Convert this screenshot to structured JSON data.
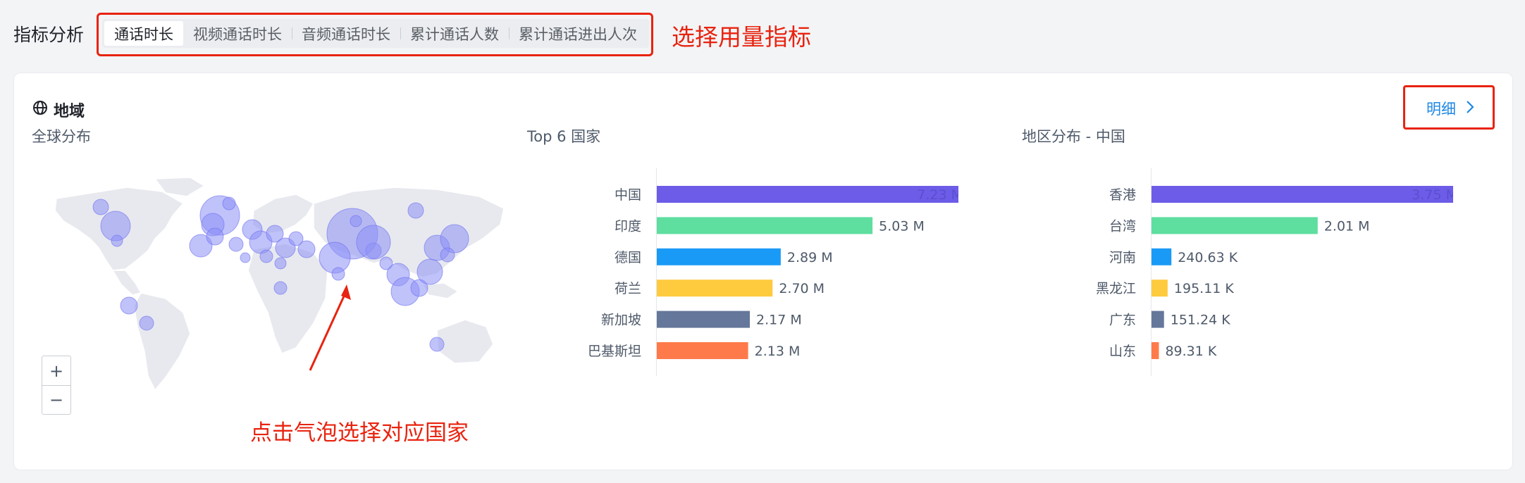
{
  "metrics": {
    "label": "指标分析",
    "tabs": [
      {
        "label": "通话时长",
        "active": true
      },
      {
        "label": "视频通话时长",
        "active": false
      },
      {
        "label": "音频通话时长",
        "active": false
      },
      {
        "label": "累计通话人数",
        "active": false
      },
      {
        "label": "累计通话进出人次",
        "active": false
      }
    ],
    "annotation": "选择用量指标"
  },
  "card": {
    "title": "地域",
    "detail_link": "明细",
    "global_title": "全球分布",
    "map_annotation": "点击气泡选择对应国家",
    "zoom_in": "+",
    "zoom_out": "−"
  },
  "colors": {
    "accent": "#1e88e5",
    "annotation": "#e8230f",
    "bubble": "#8c8ff5"
  },
  "chart_data": [
    {
      "type": "bar",
      "orientation": "horizontal",
      "title": "Top 6 国家",
      "categories": [
        "中国",
        "印度",
        "德国",
        "荷兰",
        "新加坡",
        "巴基斯坦"
      ],
      "values": [
        7.23,
        5.03,
        2.89,
        2.7,
        2.17,
        2.13
      ],
      "value_labels": [
        "7.23 M",
        "5.03 M",
        "2.89 M",
        "2.70 M",
        "2.17 M",
        "2.13 M"
      ],
      "colors": [
        "#6c5ce7",
        "#5ede9f",
        "#1a9af7",
        "#fecb3f",
        "#65779a",
        "#ff7a4a"
      ],
      "xlim": [
        0,
        7.23
      ]
    },
    {
      "type": "bar",
      "orientation": "horizontal",
      "title": "地区分布 - 中国",
      "categories": [
        "香港",
        "台湾",
        "河南",
        "黑龙江",
        "广东",
        "山东"
      ],
      "values": [
        3.75,
        2.01,
        0.24063,
        0.19511,
        0.15124,
        0.08931
      ],
      "value_labels": [
        "3.75 M",
        "2.01 M",
        "240.63 K",
        "195.11 K",
        "151.24 K",
        "89.31 K"
      ],
      "colors": [
        "#6c5ce7",
        "#5ede9f",
        "#1a9af7",
        "#fecb3f",
        "#65779a",
        "#ff7a4a"
      ],
      "xlim": [
        0,
        3.75
      ]
    }
  ]
}
